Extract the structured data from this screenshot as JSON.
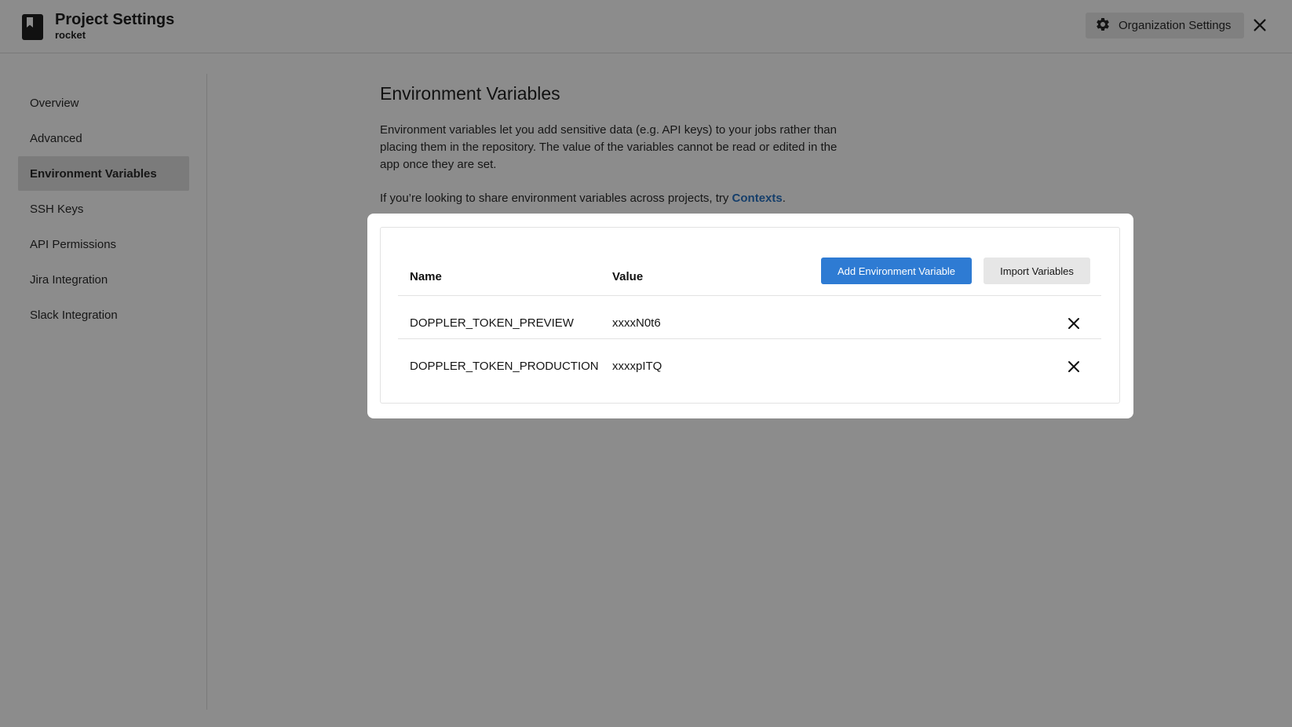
{
  "header": {
    "title": "Project Settings",
    "project_name": "rocket",
    "org_settings_label": "Organization Settings",
    "icons": {
      "logo": "bookmark-icon",
      "org": "gear-icon",
      "close": "close-icon"
    }
  },
  "sidebar": {
    "items": [
      {
        "label": "Overview",
        "active": false
      },
      {
        "label": "Advanced",
        "active": false
      },
      {
        "label": "Environment Variables",
        "active": true
      },
      {
        "label": "SSH Keys",
        "active": false
      },
      {
        "label": "API Permissions",
        "active": false
      },
      {
        "label": "Jira Integration",
        "active": false
      },
      {
        "label": "Slack Integration",
        "active": false
      }
    ]
  },
  "main": {
    "heading": "Environment Variables",
    "description": "Environment variables let you add sensitive data (e.g. API keys) to your jobs rather than placing them in the repository. The value of the variables cannot be read or edited in the app once they are set.",
    "share_text": "If you’re looking to share environment variables across projects, try",
    "contexts_link": "Contexts",
    "share_suffix": "."
  },
  "table": {
    "name_header": "Name",
    "value_header": "Value",
    "add_button": "Add Environment Variable",
    "import_button": "Import Variables",
    "rows": [
      {
        "name": "DOPPLER_TOKEN_PREVIEW",
        "value": "xxxxN0t6"
      },
      {
        "name": "DOPPLER_TOKEN_PRODUCTION",
        "value": "xxxxpITQ"
      }
    ]
  },
  "colors": {
    "overlay": "#8c8c8c",
    "primary_button": "#2e7bd3",
    "link": "#163f6b"
  }
}
